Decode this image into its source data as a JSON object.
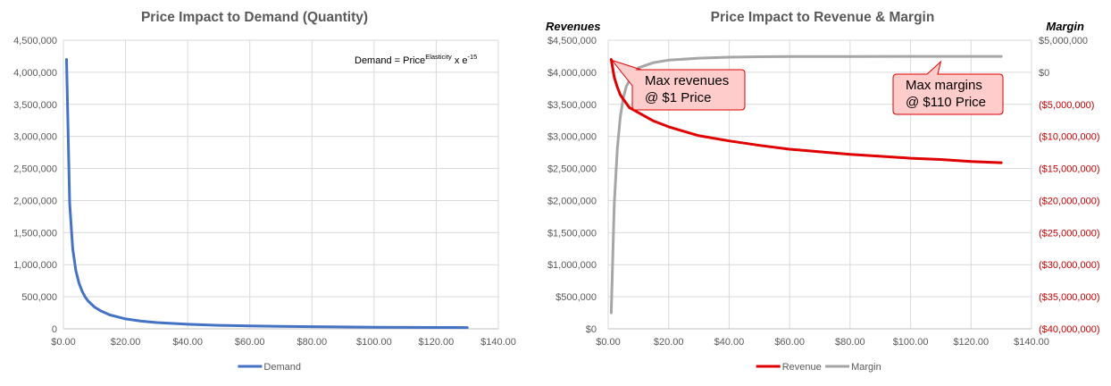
{
  "chart_data": [
    {
      "type": "line",
      "title": "Price Impact to Demand (Quantity)",
      "annotation": {
        "base": "Demand = Price",
        "sup1": "Elasticity",
        "mid": " x e",
        "sup2": "-15"
      },
      "xlim": [
        0,
        140
      ],
      "xticks": [
        0,
        20,
        40,
        60,
        80,
        100,
        120,
        140
      ],
      "xtick_labels": [
        "$0.00",
        "$20.00",
        "$40.00",
        "$60.00",
        "$80.00",
        "$100.00",
        "$120.00",
        "$140.00"
      ],
      "ylim": [
        0,
        4500000
      ],
      "yticks": [
        0,
        500000,
        1000000,
        1500000,
        2000000,
        2500000,
        3000000,
        3500000,
        4000000,
        4500000
      ],
      "ytick_labels": [
        "0",
        "500,000",
        "1,000,000",
        "1,500,000",
        "2,000,000",
        "2,500,000",
        "3,000,000",
        "3,500,000",
        "4,000,000",
        "4,500,000"
      ],
      "grid": true,
      "legend_position": "bottom",
      "series": [
        {
          "name": "Demand",
          "color": "#4472C4",
          "x": [
            1,
            2,
            3,
            4,
            5,
            6,
            7,
            8,
            10,
            12,
            15,
            20,
            25,
            30,
            40,
            50,
            60,
            70,
            80,
            100,
            120,
            130
          ],
          "y": [
            4200000,
            1960000,
            1250000,
            910000,
            715000,
            588000,
            498000,
            432000,
            340000,
            280000,
            216000,
            155000,
            120000,
            98000,
            71000,
            55000,
            45000,
            38000,
            33000,
            25500,
            20800,
            19000
          ]
        }
      ]
    },
    {
      "type": "line",
      "title": "Price Impact to Revenue & Margin",
      "ylabel": "Revenues",
      "y2label": "Margin",
      "xlim": [
        0,
        140
      ],
      "xticks": [
        0,
        20,
        40,
        60,
        80,
        100,
        120,
        140
      ],
      "xtick_labels": [
        "$0.00",
        "$20.00",
        "$40.00",
        "$60.00",
        "$80.00",
        "$100.00",
        "$120.00",
        "$140.00"
      ],
      "ylim": [
        0,
        4500000
      ],
      "yticks": [
        0,
        500000,
        1000000,
        1500000,
        2000000,
        2500000,
        3000000,
        3500000,
        4000000,
        4500000
      ],
      "ytick_labels": [
        "$0",
        "$500,000",
        "$1,000,000",
        "$1,500,000",
        "$2,000,000",
        "$2,500,000",
        "$3,000,000",
        "$3,500,000",
        "$4,000,000",
        "$4,500,000"
      ],
      "y2lim": [
        -40000000,
        5000000
      ],
      "y2ticks": [
        5000000,
        0,
        -5000000,
        -10000000,
        -15000000,
        -20000000,
        -25000000,
        -30000000,
        -35000000,
        -40000000
      ],
      "y2tick_labels": [
        "$5,000,000",
        "$0",
        "($5,000,000)",
        "($10,000,000)",
        "($15,000,000)",
        "($20,000,000)",
        "($25,000,000)",
        "($30,000,000)",
        "($35,000,000)",
        "($40,000,000)"
      ],
      "y2_negative_color": "#C00000",
      "grid": true,
      "legend_position": "bottom",
      "series": [
        {
          "name": "Revenue",
          "axis": "left",
          "color": "#E00000",
          "x": [
            1,
            2,
            3,
            4,
            5,
            7,
            10,
            15,
            20,
            25,
            30,
            40,
            50,
            60,
            70,
            80,
            90,
            100,
            110,
            120,
            130
          ],
          "y": [
            4200000,
            3920000,
            3770000,
            3650000,
            3580000,
            3450000,
            3370000,
            3240000,
            3150000,
            3080000,
            3010000,
            2930000,
            2860000,
            2800000,
            2760000,
            2720000,
            2690000,
            2660000,
            2640000,
            2610000,
            2590000
          ]
        },
        {
          "name": "Margin",
          "axis": "right",
          "color": "#A6A6A6",
          "x": [
            1,
            2,
            3,
            4,
            5,
            6,
            8,
            10,
            15,
            20,
            30,
            40,
            50,
            60,
            80,
            100,
            110,
            120,
            130
          ],
          "y": [
            -37500000,
            -20500000,
            -12000000,
            -7000000,
            -4000000,
            -2200000,
            -400000,
            700000,
            1500000,
            1900000,
            2200000,
            2350000,
            2420000,
            2450000,
            2470000,
            2480000,
            2480000,
            2480000,
            2480000
          ]
        }
      ],
      "callouts": [
        {
          "lines": [
            "Max revenues",
            "@ $1 Price"
          ],
          "target_x": 1,
          "target_y": 4200000
        },
        {
          "lines": [
            "Max margins",
            "@ $110 Price"
          ],
          "target_x": 110,
          "target_y": 4230000
        }
      ]
    }
  ]
}
